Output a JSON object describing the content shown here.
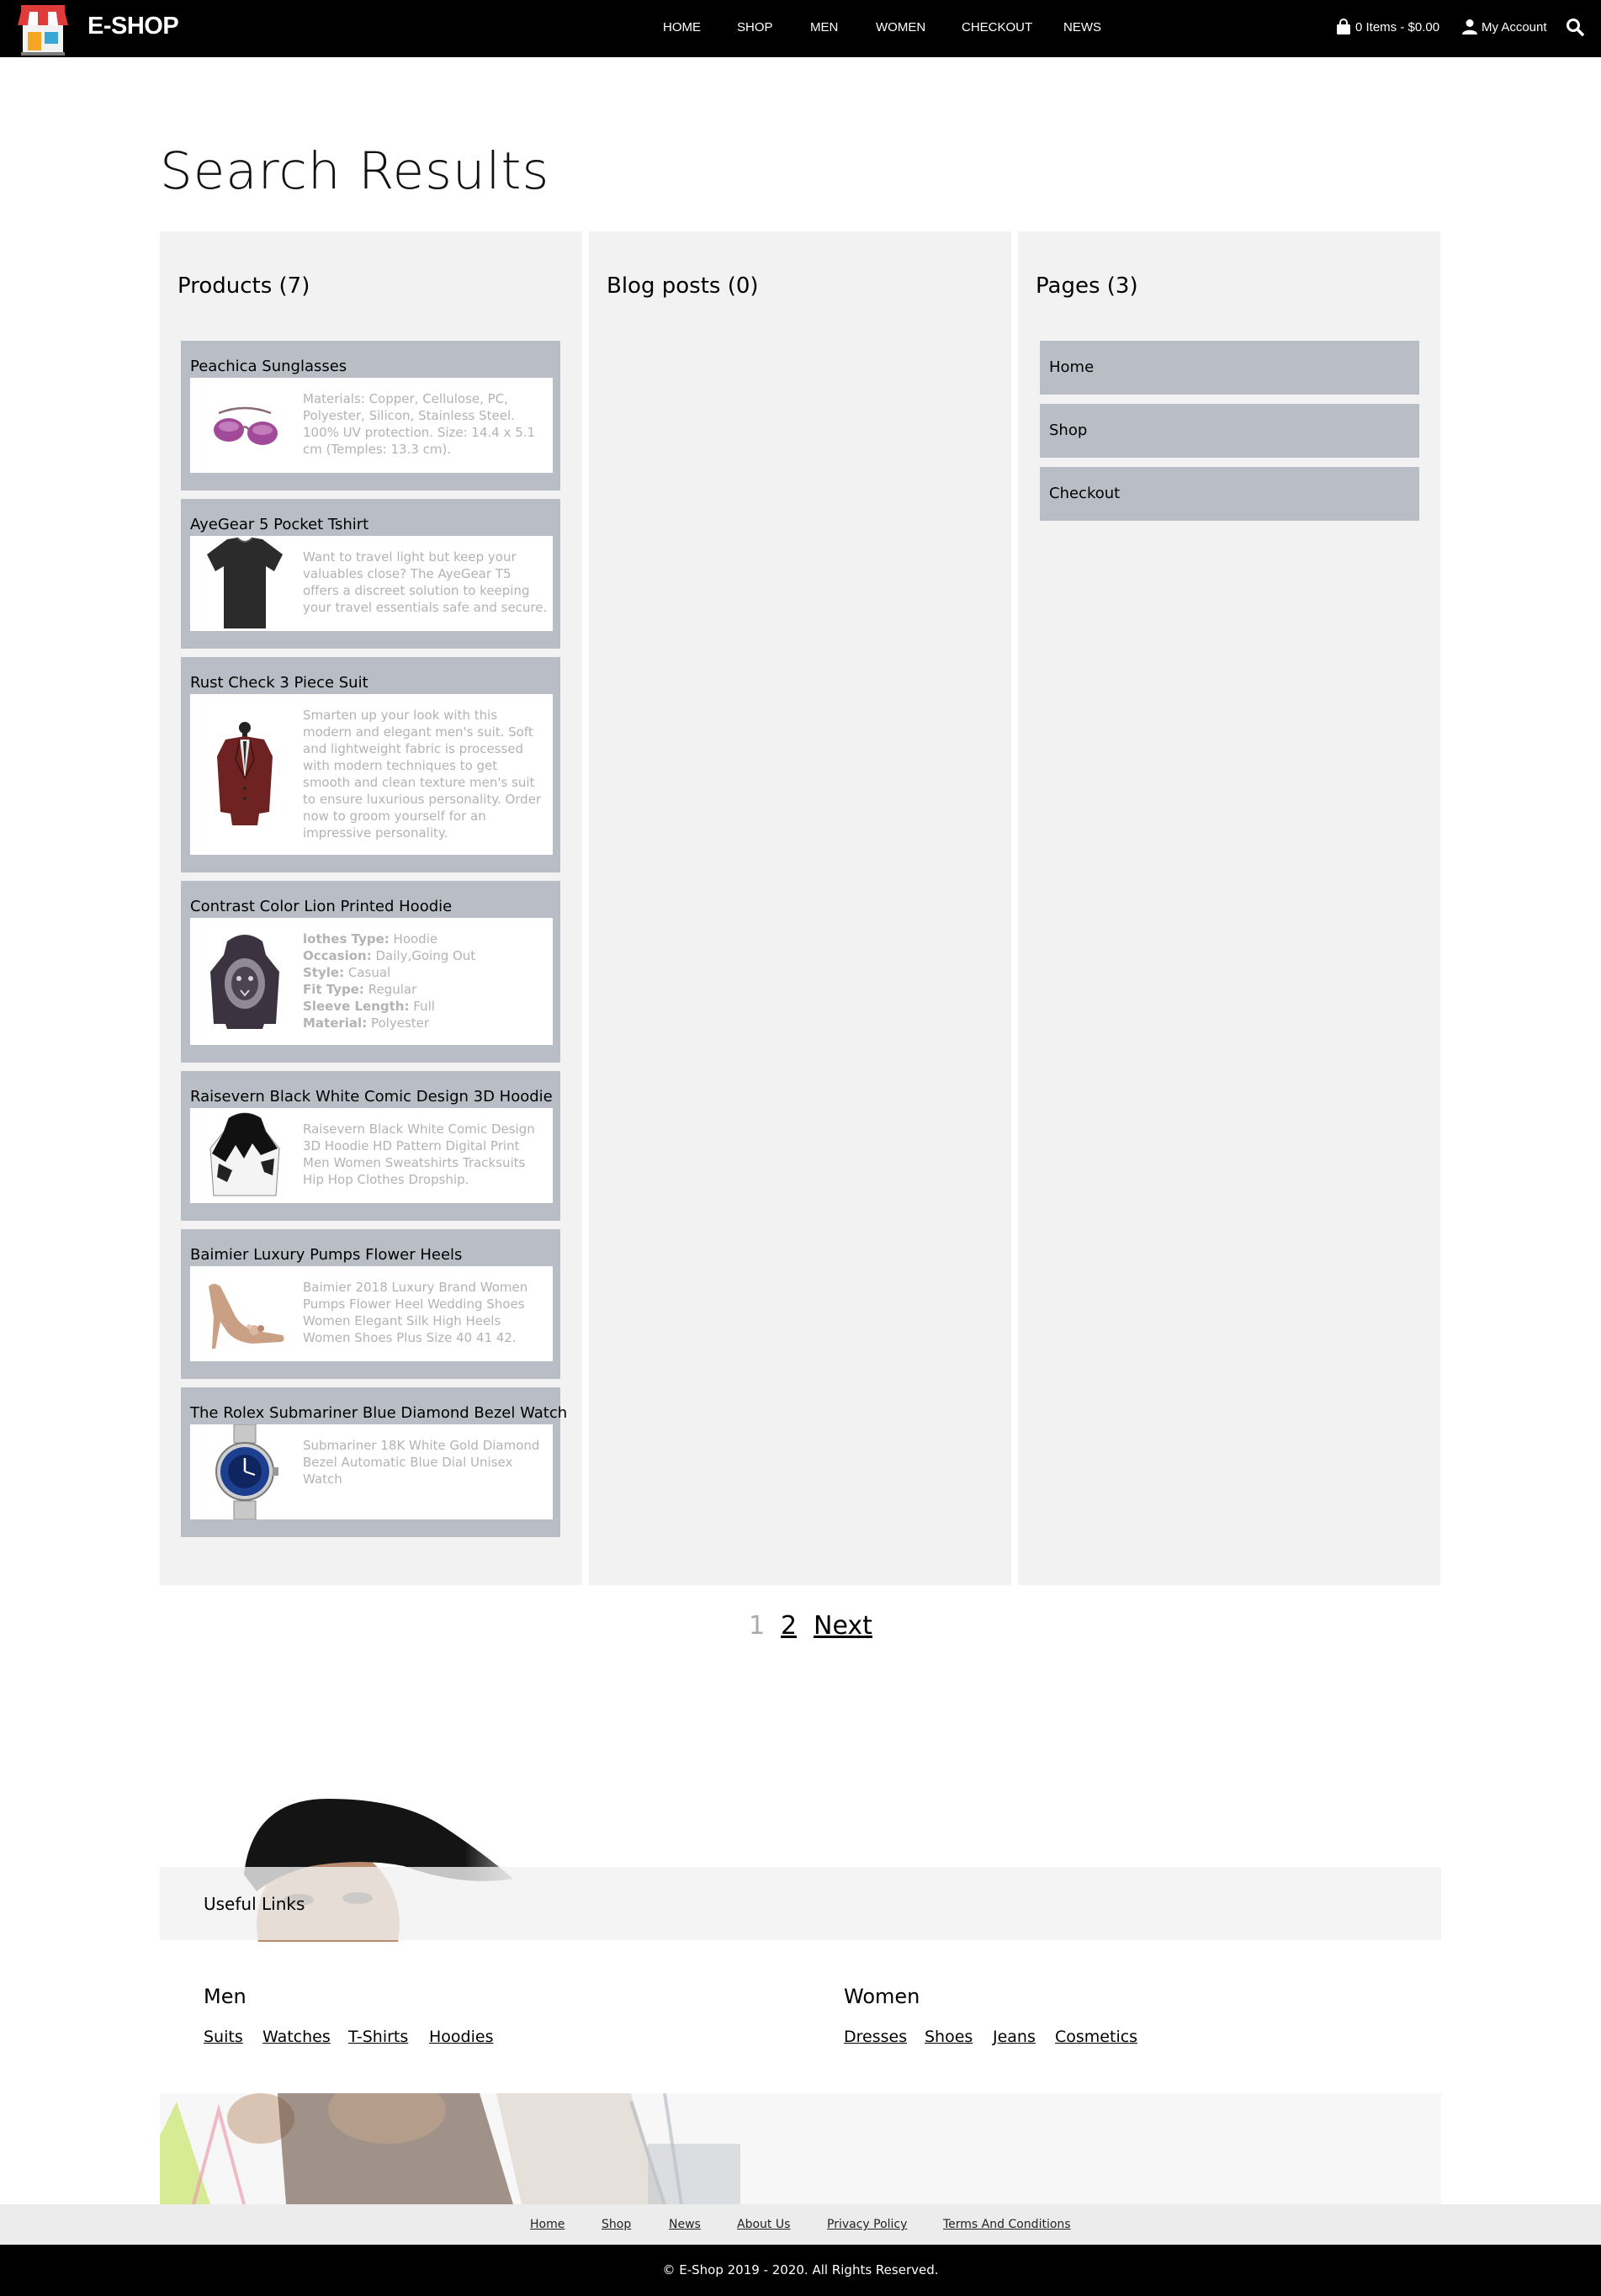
{
  "header": {
    "brand": "E-SHOP",
    "nav": [
      "HOME",
      "SHOP",
      "MEN",
      "WOMEN",
      "CHECKOUT",
      "NEWS"
    ],
    "cart_label": "0 Items - $0.00",
    "account_label": "My Account",
    "icons": {
      "logo": "shop-storefront-icon",
      "cart": "shopping-bag-icon",
      "account": "user-icon",
      "search": "search-icon"
    }
  },
  "page": {
    "title": "Search Results"
  },
  "products": {
    "heading": "Products (7)",
    "items": [
      {
        "name": "Peachica Sunglasses",
        "image": "sunglasses",
        "description": "Materials: Copper, Cellulose, PC, Polyester, Silicon, Stainless Steel. 100% UV protection. Size: 14.4 x 5.1 cm (Temples: 13.3 cm)."
      },
      {
        "name": "AyeGear 5 Pocket Tshirt",
        "image": "black-tshirt",
        "description": "Want to travel light but keep your valuables close? The AyeGear T5 offers a discreet solution to keeping your travel essentials safe and secure."
      },
      {
        "name": "Rust Check 3 Piece Suit",
        "image": "suit-jacket",
        "description": "Smarten up your look with this modern and elegant men's suit. Soft and lightweight fabric is processed with modern techniques to get smooth and clean texture men's suit to ensure luxurious personality. Order now to groom yourself for an impressive personality."
      },
      {
        "name": "Contrast Color Lion Printed Hoodie",
        "image": "lion-hoodie",
        "specs": [
          {
            "label": "lothes Type:",
            "value": "Hoodie"
          },
          {
            "label": "Occasion:",
            "value": "Daily,Going Out"
          },
          {
            "label": "Style:",
            "value": "Casual"
          },
          {
            "label": "Fit Type:",
            "value": "Regular"
          },
          {
            "label": "Sleeve Length:",
            "value": "Full"
          },
          {
            "label": "Material:",
            "value": "Polyester"
          }
        ]
      },
      {
        "name": "Raisevern Black White Comic Design 3D Hoodie",
        "image": "comic-hoodie",
        "description": "Raisevern Black White Comic Design 3D Hoodie HD Pattern Digital Print Men Women Sweatshirts Tracksuits Hip Hop Clothes Dropship."
      },
      {
        "name": "Baimier Luxury Pumps Flower Heels",
        "image": "flower-heels",
        "description": "Baimier 2018 Luxury Brand Women Pumps Flower Heel Wedding Shoes Women Elegant Silk High Heels Women Shoes Plus Size 40 41 42."
      },
      {
        "name": "The Rolex Submariner Blue Diamond Bezel Watch",
        "image": "blue-watch",
        "description": "Submariner 18K White Gold Diamond Bezel Automatic Blue Dial Unisex Watch"
      }
    ]
  },
  "blog": {
    "heading": "Blog posts (0)"
  },
  "pages": {
    "heading": "Pages (3)",
    "items": [
      "Home",
      "Shop",
      "Checkout"
    ]
  },
  "pagination": {
    "current": "1",
    "next_page": "2",
    "next_label": "Next"
  },
  "footer": {
    "useful_links_title": "Useful Links",
    "men": {
      "title": "Men",
      "links": [
        "Suits",
        "Watches",
        "T-Shirts",
        "Hoodies"
      ]
    },
    "women": {
      "title": "Women",
      "links": [
        "Dresses",
        "Shoes",
        "Jeans",
        "Cosmetics"
      ]
    },
    "nav": [
      "Home",
      "Shop",
      "News",
      "About Us",
      "Privacy Policy",
      "Terms And Conditions"
    ],
    "copyright": "© E-Shop 2019 - 2020. All Rights Reserved."
  }
}
